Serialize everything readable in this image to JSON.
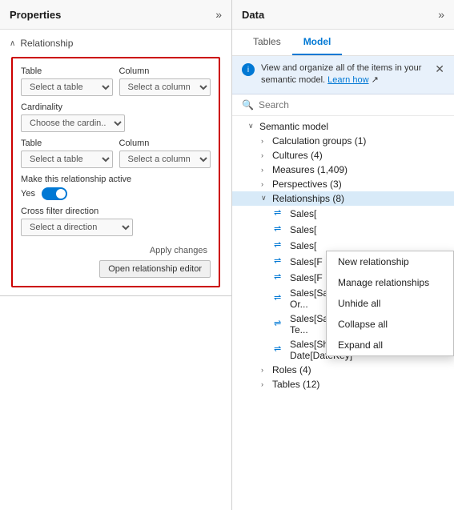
{
  "left_panel": {
    "title": "Properties",
    "expand_icon": "»",
    "relationship_section": {
      "label": "Relationship",
      "form": {
        "table1_label": "Table",
        "table1_placeholder": "Select a table",
        "column1_label": "Column",
        "column1_placeholder": "Select a column",
        "cardinality_label": "Cardinality",
        "cardinality_placeholder": "Choose the cardin...",
        "table2_label": "Table",
        "table2_placeholder": "Select a table",
        "column2_label": "Column",
        "column2_placeholder": "Select a column",
        "active_label": "Make this relationship active",
        "toggle_yes": "Yes",
        "direction_label": "Cross filter direction",
        "direction_placeholder": "Select a direction",
        "apply_label": "Apply changes",
        "editor_label": "Open relationship editor"
      }
    }
  },
  "right_panel": {
    "title": "Data",
    "expand_icon": "»",
    "tabs": [
      {
        "label": "Tables",
        "active": false
      },
      {
        "label": "Model",
        "active": true
      }
    ],
    "info_bar": {
      "text": "View and organize all of the items in your semantic model.",
      "link_text": "Learn how",
      "link_icon": "↗"
    },
    "search_placeholder": "Search",
    "tree": {
      "root_label": "Semantic model",
      "items": [
        {
          "label": "Calculation groups (1)",
          "indent": 2,
          "expanded": false
        },
        {
          "label": "Cultures (4)",
          "indent": 2,
          "expanded": false
        },
        {
          "label": "Measures (1,409)",
          "indent": 2,
          "expanded": false
        },
        {
          "label": "Perspectives (3)",
          "indent": 2,
          "expanded": false
        },
        {
          "label": "Relationships (8)",
          "indent": 2,
          "expanded": true,
          "highlighted": true
        },
        {
          "label": "Sales[",
          "indent": 3,
          "is_rel": true
        },
        {
          "label": "Sales[",
          "indent": 3,
          "is_rel": true
        },
        {
          "label": "Sales[",
          "indent": 3,
          "is_rel": true
        },
        {
          "label": "Sales[F",
          "indent": 3,
          "is_rel": true
        },
        {
          "label": "Sales[F",
          "indent": 3,
          "is_rel": true
        },
        {
          "label": "Sales[SalesOrderLineKey] — Sales Or...",
          "indent": 3,
          "is_rel": true
        },
        {
          "label": "Sales[SalesTerritoryKey] <— Sales Te...",
          "indent": 3,
          "is_rel": true
        },
        {
          "label": "Sales[ShipDateKey] <— Date[DateKey]",
          "indent": 3,
          "is_rel": true
        },
        {
          "label": "Roles (4)",
          "indent": 2,
          "expanded": false
        },
        {
          "label": "Tables (12)",
          "indent": 2,
          "expanded": false
        }
      ]
    },
    "context_menu": {
      "items": [
        {
          "label": "New relationship"
        },
        {
          "label": "Manage relationships"
        },
        {
          "label": "Unhide all"
        },
        {
          "label": "Collapse all"
        },
        {
          "label": "Expand all"
        }
      ]
    }
  }
}
